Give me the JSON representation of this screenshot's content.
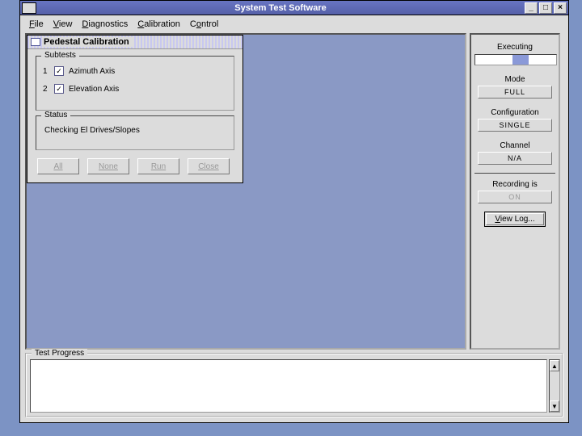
{
  "window": {
    "title": "System Test Software",
    "min": "_",
    "max": "□",
    "close": "×"
  },
  "menu": {
    "file": "File",
    "view": "View",
    "diagnostics": "Diagnostics",
    "calibration": "Calibration",
    "control": "Control"
  },
  "dialog": {
    "title": "Pedestal Calibration",
    "subtests_legend": "Subtests",
    "subtests": [
      {
        "num": "1",
        "label": "Azimuth Axis",
        "checked": true
      },
      {
        "num": "2",
        "label": "Elevation Axis",
        "checked": true
      }
    ],
    "status_legend": "Status",
    "status_text": "Checking El Drives/Slopes",
    "buttons": {
      "all": "All",
      "none": "None",
      "run": "Run",
      "close": "Close"
    }
  },
  "sidebar": {
    "executing": "Executing",
    "mode_label": "Mode",
    "mode_value": "FULL",
    "config_label": "Configuration",
    "config_value": "SINGLE",
    "channel_label": "Channel",
    "channel_value": "N/A",
    "recording_label": "Recording is",
    "recording_value": "ON",
    "viewlog": "View Log..."
  },
  "bottom": {
    "legend": "Test Progress"
  }
}
